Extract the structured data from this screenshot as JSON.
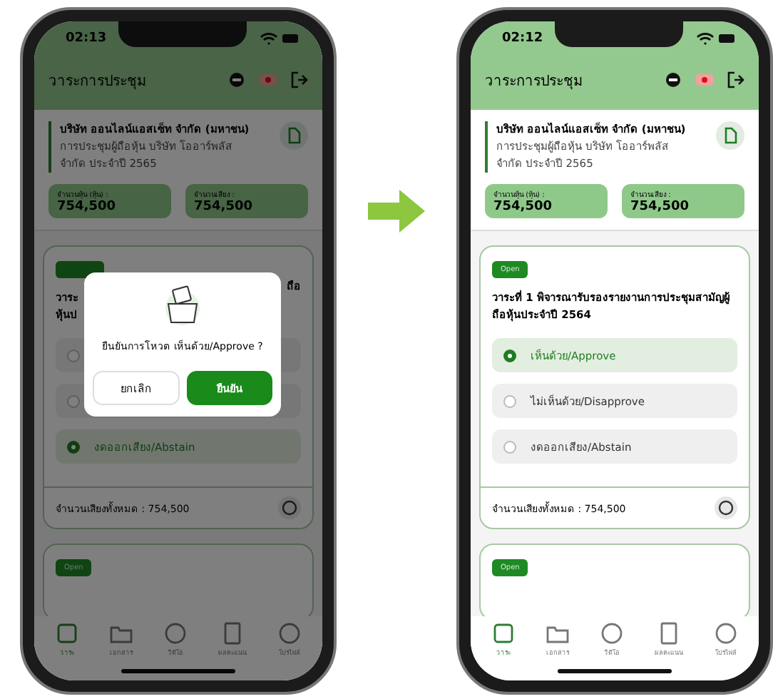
{
  "phones": [
    {
      "time": "02:13",
      "header": {
        "title": "วาระการประชุม"
      },
      "company": {
        "name": "บริษัท ออนไลน์แอสเซ็ท จำกัด (มหาชน)",
        "line1": "การประชุมผู้ถือหุ้น บริษัท โออาร์พลัส",
        "line2": "จำกัด ประจำปี 2565"
      },
      "stats": [
        {
          "label": "จำนวนหุ้น (หุ้น) :",
          "value": "754,500"
        },
        {
          "label": "จำนวนเสียง :",
          "value": "754,500"
        }
      ],
      "agenda": {
        "title_parts": [
          "วาระ",
          "ถือ"
        ],
        "title_line2": "หุ้นป",
        "options": [
          {
            "selected": false
          },
          {
            "selected": false
          },
          {
            "label": "งดออกเสียง/Abstain",
            "selected": true
          }
        ],
        "total": "จำนวนเสียงทั้งหมด : 754,500"
      },
      "next_tag": "Open",
      "nav": [
        {
          "label": "วาระ",
          "selected": true
        },
        {
          "label": "เอกสาร",
          "selected": false
        },
        {
          "label": "วิดีโอ",
          "selected": false
        },
        {
          "label": "ผลคะแนน",
          "selected": false
        },
        {
          "label": "โปรไฟล์",
          "selected": false
        }
      ],
      "dialog": {
        "message": "ยืนยันการโหวต  เห็นด้วย/Approve ?",
        "buttons": [
          {
            "label": "ยกเลิก",
            "kind": "cancel"
          },
          {
            "label": "ยืนยัน",
            "kind": "confirm"
          }
        ]
      }
    },
    {
      "time": "02:12",
      "header": {
        "title": "วาระการประชุม"
      },
      "company": {
        "name": "บริษัท ออนไลน์แอสเซ็ท จำกัด (มหาชน)",
        "line1": "การประชุมผู้ถือหุ้น บริษัท โออาร์พลัส",
        "line2": "จำกัด ประจำปี 2565"
      },
      "stats": [
        {
          "label": "จำนวนหุ้น (หุ้น) :",
          "value": "754,500"
        },
        {
          "label": "จำนวนเสียง :",
          "value": "754,500"
        }
      ],
      "agenda": {
        "tag": "Open",
        "title": "วาระที่ 1 พิจารณารับรองรายงานการประชุมสามัญผู้ถือหุ้นประจำปี 2564",
        "options": [
          {
            "label": "เห็นด้วย/Approve",
            "selected": true
          },
          {
            "label": "ไม่เห็นด้วย/Disapprove",
            "selected": false
          },
          {
            "label": "งดออกเสียง/Abstain",
            "selected": false
          }
        ],
        "total": "จำนวนเสียงทั้งหมด : 754,500"
      },
      "next_tag": "Open",
      "nav": [
        {
          "label": "วาระ",
          "selected": true
        },
        {
          "label": "เอกสาร",
          "selected": false
        },
        {
          "label": "วิดีโอ",
          "selected": false
        },
        {
          "label": "ผลคะแนน",
          "selected": false
        },
        {
          "label": "โปรไฟล์",
          "selected": false
        }
      ]
    }
  ]
}
